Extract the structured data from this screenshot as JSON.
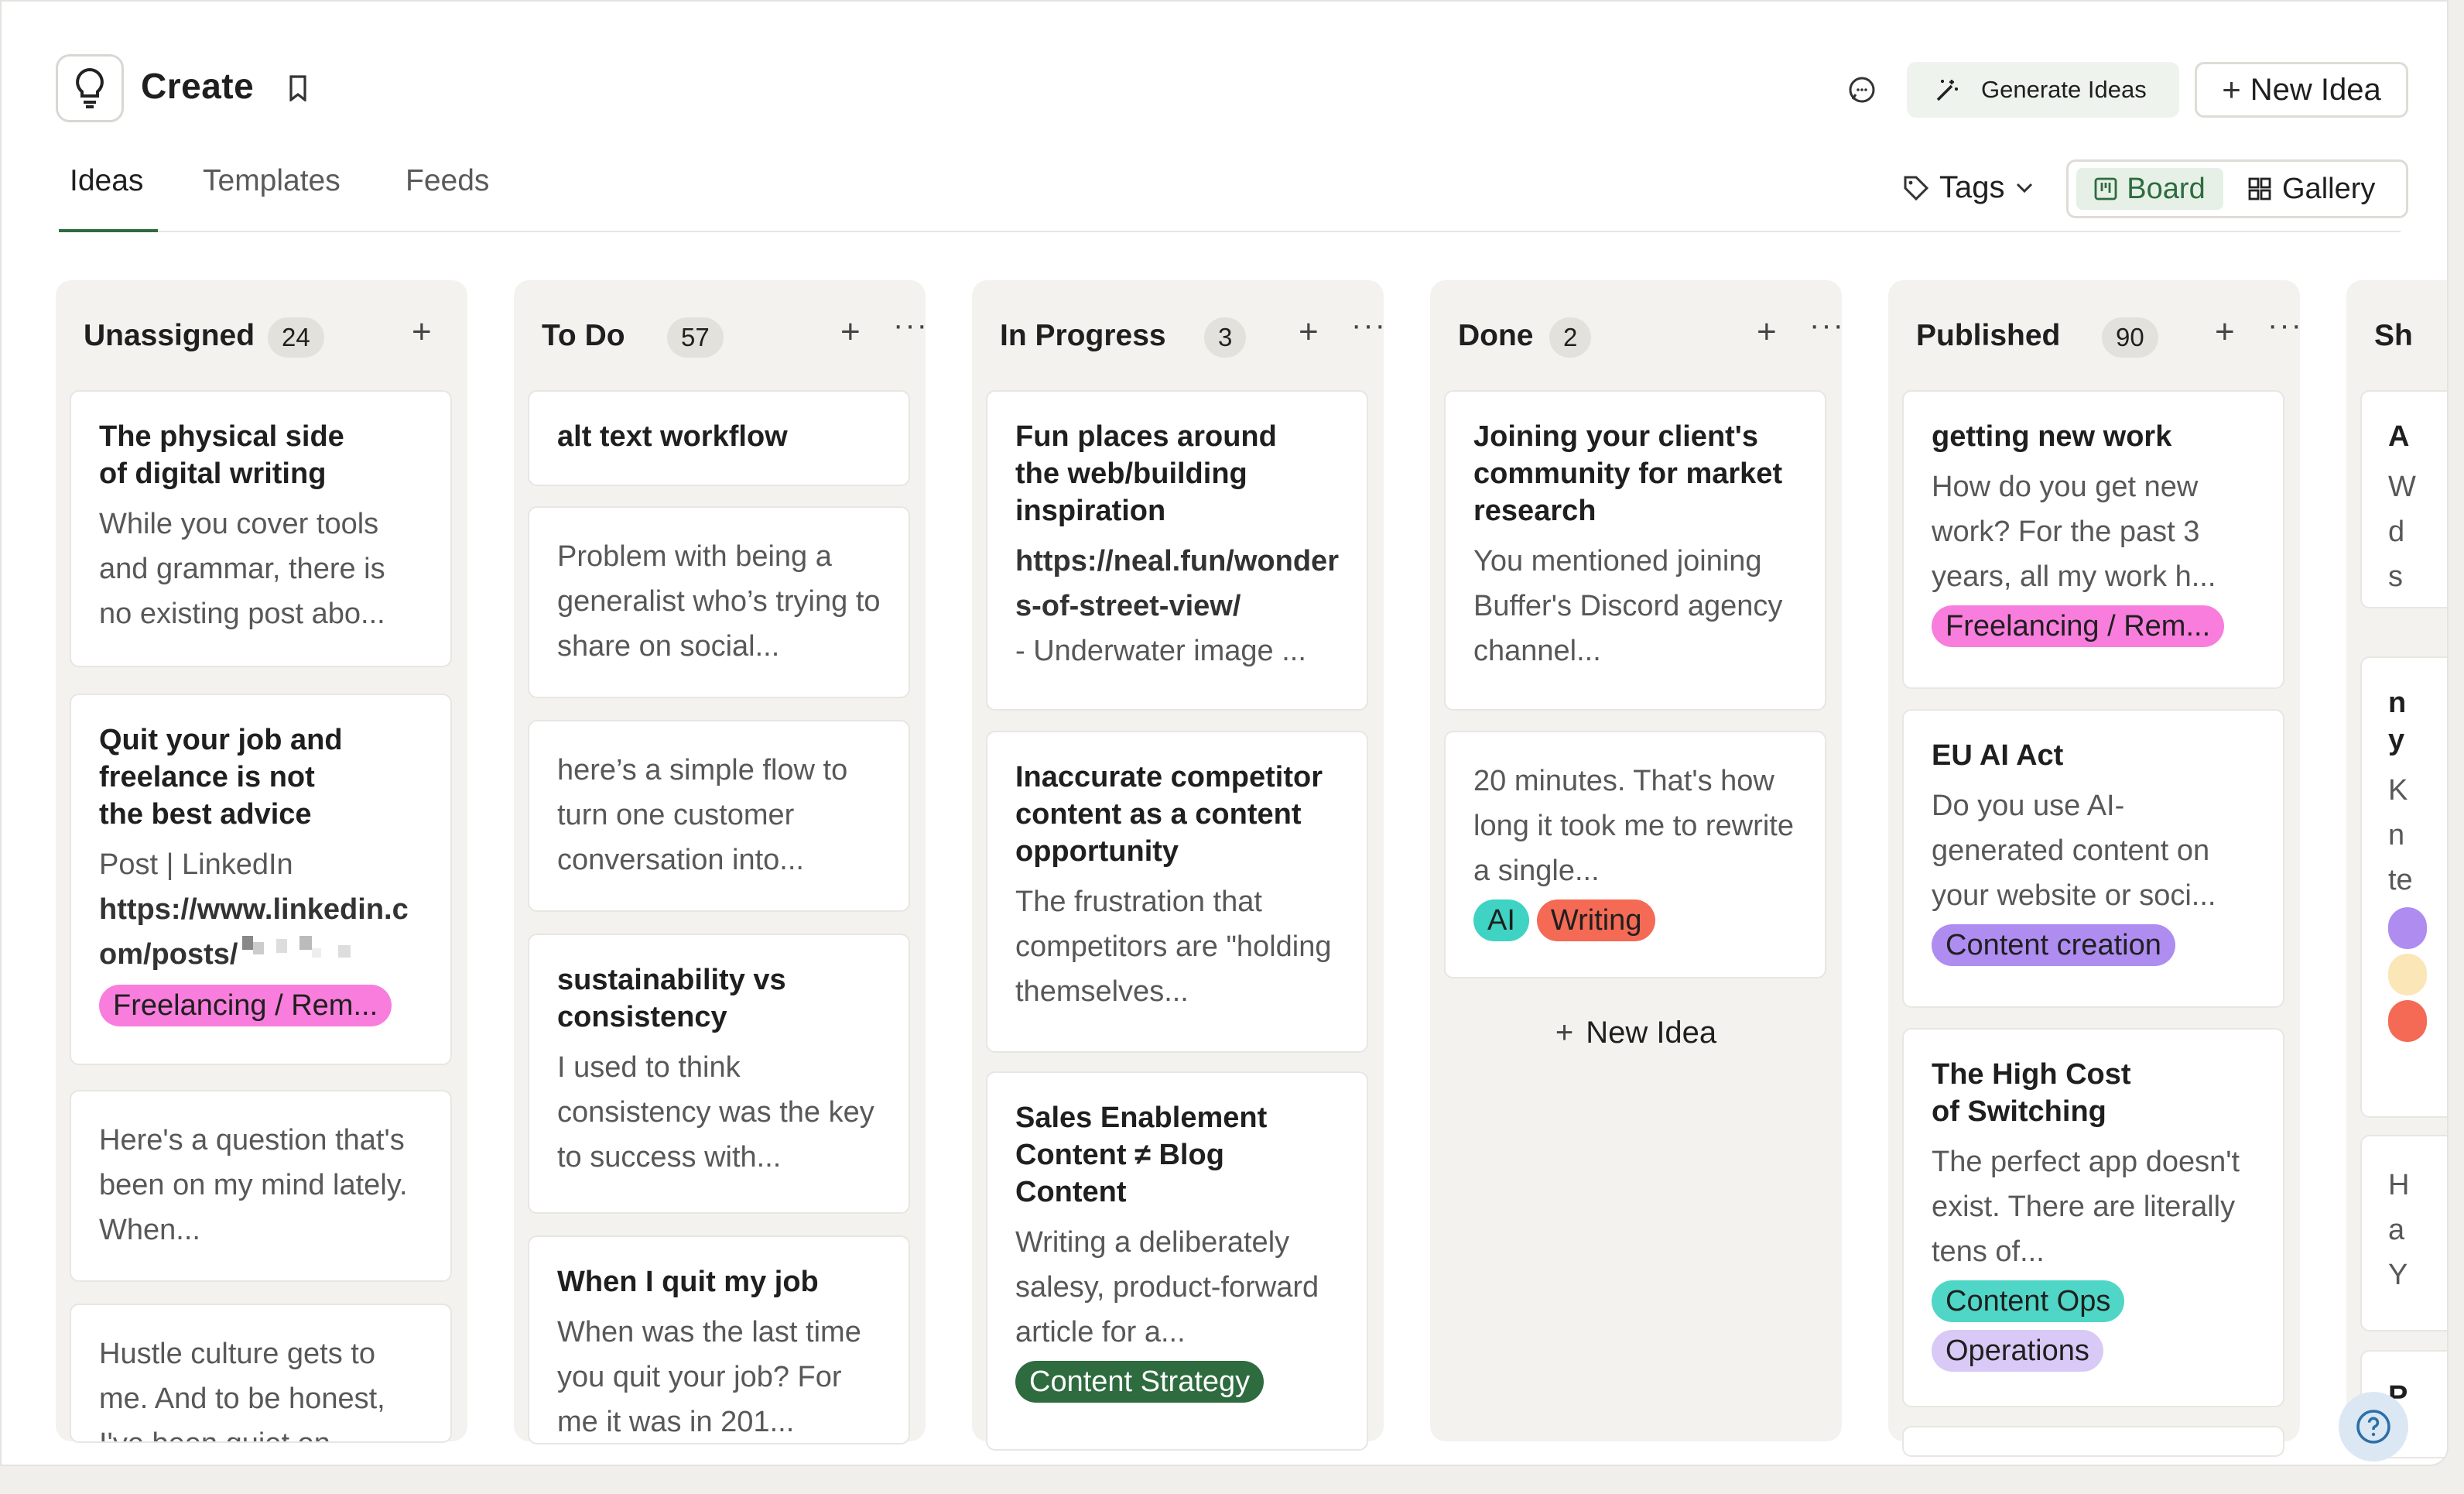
{
  "header": {
    "title": "Create",
    "generate_label": "Generate Ideas",
    "new_idea_label": "New Idea"
  },
  "tabs": [
    {
      "label": "Ideas",
      "active": true
    },
    {
      "label": "Templates",
      "active": false
    },
    {
      "label": "Feeds",
      "active": false
    }
  ],
  "toolbar": {
    "tags_label": "Tags",
    "board_label": "Board",
    "gallery_label": "Gallery"
  },
  "columns": [
    {
      "title": "Unassigned",
      "count": "24",
      "cards": [
        {
          "title": "The physical side of digital writing",
          "body": "While you cover tools and grammar, there is no existing post abo..."
        },
        {
          "title": "Quit your job and freelance is not the best advice",
          "body_line1": "Post | LinkedIn",
          "body_link": "https://www.linkedin.com/posts/",
          "tags": [
            "Freelancing / Rem..."
          ]
        },
        {
          "body": "Here's a question that's been on my mind lately. When..."
        },
        {
          "body": "Hustle culture gets to me. And to be honest, I've been quiet on..."
        }
      ]
    },
    {
      "title": "To Do",
      "count": "57",
      "cards": [
        {
          "title": "alt text workflow"
        },
        {
          "body": "Problem with being a generalist who’s trying to share on social..."
        },
        {
          "body": "here’s a simple flow to turn one customer conversation into..."
        },
        {
          "title": "sustainability vs consistency",
          "body": "I used to think consistency was the key to success with..."
        },
        {
          "title": "When I quit my job",
          "body": "When was the last time you quit your job? For me it was in 201..."
        }
      ]
    },
    {
      "title": "In Progress",
      "count": "3",
      "cards": [
        {
          "title": "Fun places around the web/building inspiration",
          "body_link": "https://neal.fun/wonders-of-street-view/",
          "body": "- Underwater image ..."
        },
        {
          "title": "Inaccurate competitor content as a content opportunity",
          "body": "The frustration that competitors are \"holding themselves..."
        },
        {
          "title": "Sales Enablement Content ≠ Blog Content",
          "body": "Writing a deliberately salesy, product-forward article for a...",
          "tags": [
            "Content Strategy"
          ]
        }
      ]
    },
    {
      "title": "Done",
      "count": "2",
      "new_idea_label": "New Idea",
      "cards": [
        {
          "title": "Joining your client's community for market research",
          "body": "You mentioned joining Buffer's Discord agency channel..."
        },
        {
          "body": "20 minutes. That's how long it took me to rewrite a single...",
          "tags": [
            "AI",
            "Writing"
          ]
        }
      ]
    },
    {
      "title": "Published",
      "count": "90",
      "cards": [
        {
          "title": "getting new work",
          "body": "How do you get new work? For the past 3 years, all my work h...",
          "tags": [
            "Freelancing / Rem..."
          ]
        },
        {
          "title": "EU AI Act",
          "body": "Do you use AI-generated content on your website or soci...",
          "tags": [
            "Content creation"
          ]
        },
        {
          "title": "The High Cost of Switching",
          "body": "The perfect app doesn't exist. There are literally tens of...",
          "tags": [
            "Content Ops",
            "Operations"
          ]
        }
      ]
    },
    {
      "title": "Sh",
      "cards": [
        {
          "title": "A",
          "body": "W d s"
        },
        {
          "title": "n y",
          "body": "K n te"
        },
        {
          "body": "H a Y"
        },
        {
          "title": "P"
        }
      ]
    }
  ],
  "colors": {
    "accent_green": "#2e6b3f",
    "tag_pink": "#f87ddc",
    "tag_purple": "#ae8cf0",
    "tag_teal": "#4fd6c6",
    "tag_red": "#f46a55"
  }
}
